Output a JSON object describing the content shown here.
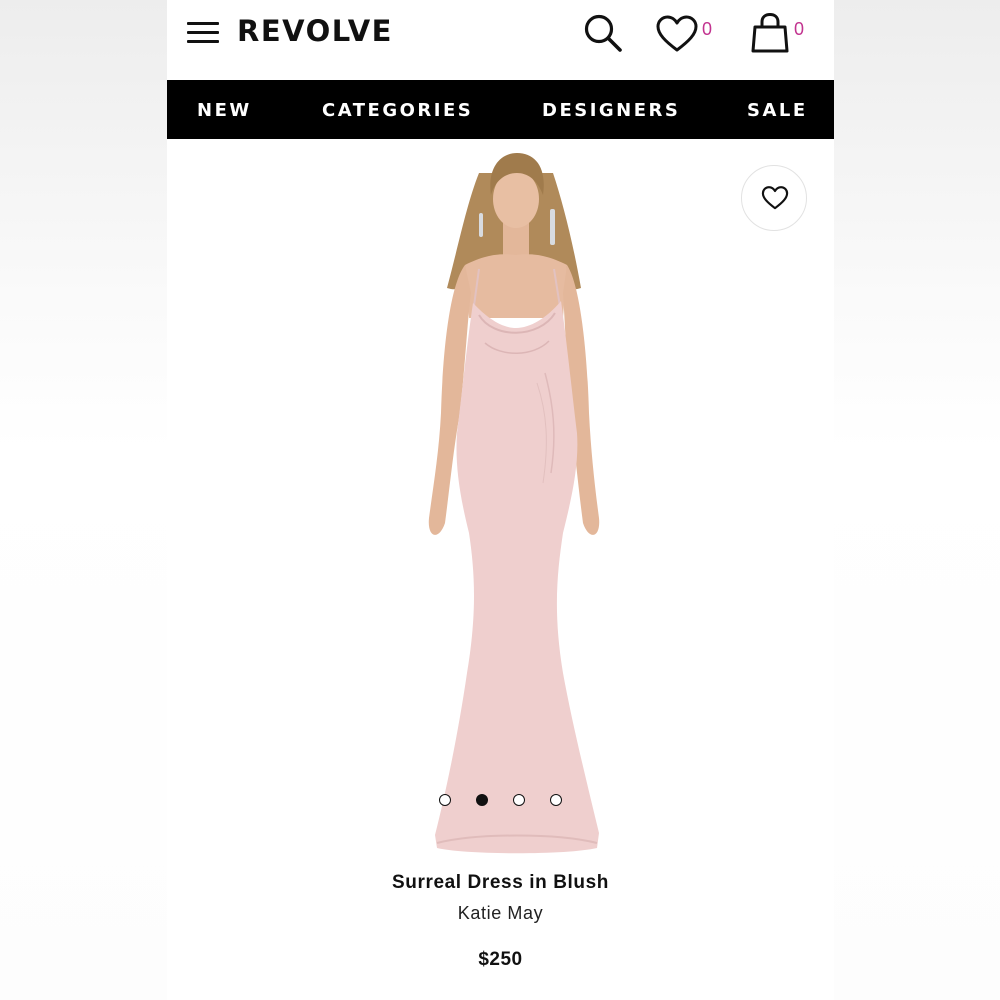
{
  "header": {
    "logo": "REVOLVE",
    "wishlist_count": "0",
    "bag_count": "0",
    "accent_color": "#c2338f",
    "icons": [
      "menu-icon",
      "search-icon",
      "heart-icon",
      "bag-icon"
    ]
  },
  "nav": {
    "items": [
      "NEW",
      "CATEGORIES",
      "DESIGNERS",
      "SALE"
    ]
  },
  "gallery": {
    "image_count": 4,
    "active_index": 1
  },
  "product": {
    "title": "Surreal Dress in Blush",
    "brand": "Katie May",
    "price": "$250",
    "dress_color": "#efcfce"
  }
}
